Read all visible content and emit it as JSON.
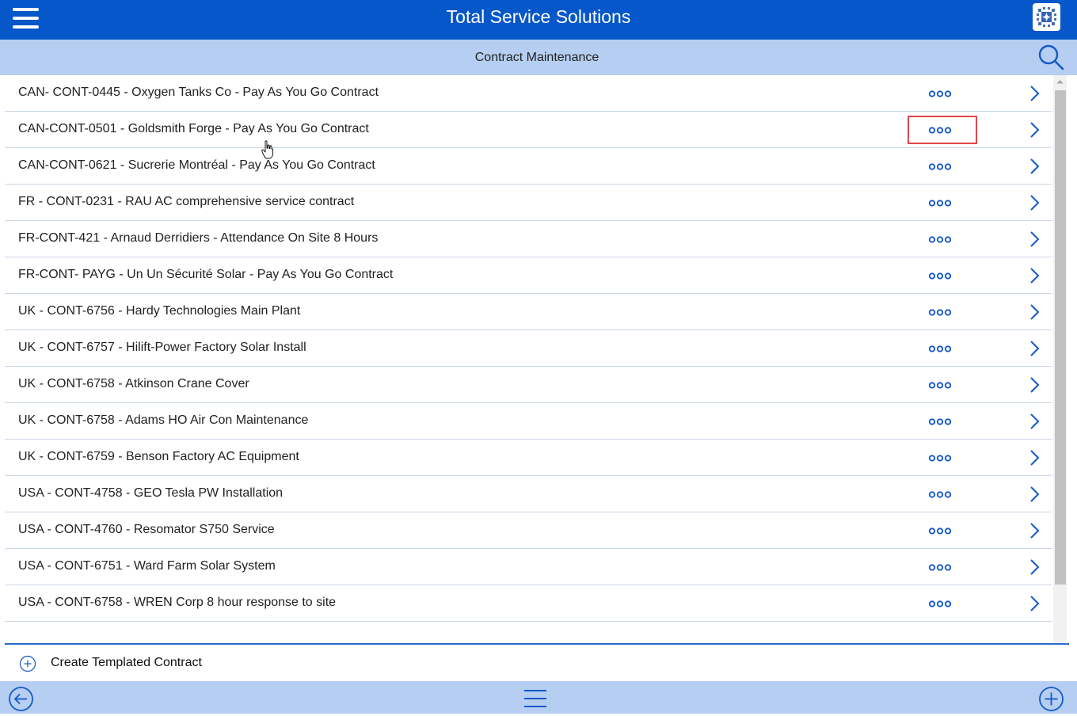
{
  "header": {
    "title": "Total Service Solutions"
  },
  "subheader": {
    "title": "Contract Maintenance"
  },
  "contracts": [
    {
      "label": "CAN- CONT-0445 - Oxygen Tanks Co - Pay As You Go Contract"
    },
    {
      "label": "CAN-CONT-0501 - Goldsmith Forge - Pay As You Go Contract",
      "highlighted": true
    },
    {
      "label": "CAN-CONT-0621 - Sucrerie Montréal - Pay As You Go Contract"
    },
    {
      "label": "FR - CONT-0231 - RAU AC comprehensive service contract"
    },
    {
      "label": "FR-CONT-421 - Arnaud Derridiers - Attendance On Site 8 Hours"
    },
    {
      "label": "FR-CONT- PAYG - Un Un Sécurité Solar - Pay As You Go Contract"
    },
    {
      "label": "UK - CONT-6756 - Hardy Technologies Main Plant"
    },
    {
      "label": "UK - CONT-6757 - Hilift-Power Factory Solar Install"
    },
    {
      "label": "UK - CONT-6758 - Atkinson Crane Cover"
    },
    {
      "label": "UK - CONT-6758 - Adams HO Air Con Maintenance"
    },
    {
      "label": "UK - CONT-6759 - Benson Factory AC Equipment"
    },
    {
      "label": "USA - CONT-4758 - GEO Tesla PW Installation"
    },
    {
      "label": "USA - CONT-4760 - Resomator S750 Service"
    },
    {
      "label": "USA - CONT-6751 - Ward Farm Solar System"
    },
    {
      "label": "USA - CONT-6758 - WREN Corp 8 hour response to site"
    }
  ],
  "footer": {
    "create_label": "Create Templated Contract"
  },
  "icons": {
    "menu": "hamburger-icon",
    "logo": "app-logo-icon",
    "search": "search-icon",
    "more": "more-dots-icon",
    "chevron": "chevron-right-icon",
    "create": "plus-circle-icon",
    "back": "back-arrow-icon",
    "nav": "hamburger-icon",
    "add": "plus-circle-icon"
  },
  "colors": {
    "primary": "#0657c9",
    "subbar": "#b5cef1",
    "accent": "#1559c6",
    "highlight": "#e0474c"
  }
}
